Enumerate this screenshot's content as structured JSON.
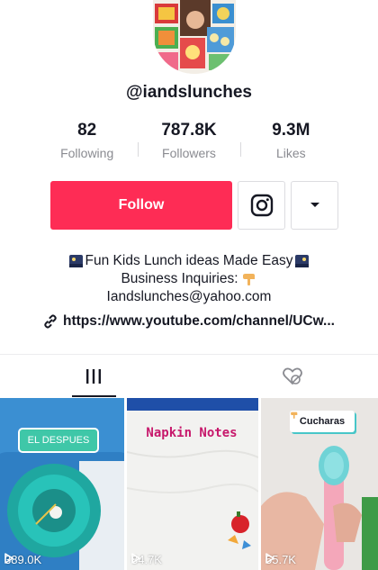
{
  "profile": {
    "username": "@iandslunches"
  },
  "stats": [
    {
      "value": "82",
      "label": "Following"
    },
    {
      "value": "787.8K",
      "label": "Followers"
    },
    {
      "value": "9.3M",
      "label": "Likes"
    }
  ],
  "actions": {
    "follow_label": "Follow",
    "instagram_icon": "instagram-icon",
    "more_icon": "caret-down-icon"
  },
  "bio": {
    "line1": "Fun Kids Lunch ideas Made Easy",
    "line2": "Business Inquiries:",
    "line3": "Iandslunches@yahoo.com"
  },
  "link": {
    "text": "https://www.youtube.com/channel/UCw..."
  },
  "tabs": [
    {
      "icon": "grid-icon",
      "active": true
    },
    {
      "icon": "liked-hidden-icon",
      "active": false
    }
  ],
  "videos": [
    {
      "overlay": "EL DESPUES",
      "views": "389.0K"
    },
    {
      "overlay": "Napkin Notes",
      "views": "84.7K"
    },
    {
      "overlay": "Cucharas",
      "views": "55.7K"
    }
  ],
  "colors": {
    "accent": "#fe2c55",
    "text": "#161823",
    "muted": "#8a8b91"
  }
}
